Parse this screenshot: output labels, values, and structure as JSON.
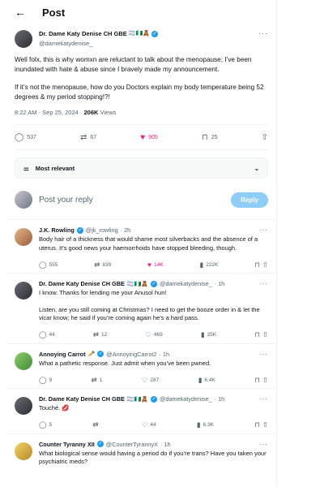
{
  "header": {
    "back_icon": "arrow-left-icon",
    "title": "Post"
  },
  "post": {
    "author_name": "Dr. Dame Katy Denise CH GBE",
    "author_emoji": "🏳️‍⚧️🇳🇬🧸",
    "handle": "@damekatydenise_",
    "more": "···",
    "paragraphs": [
      "Well folx, this is why womxn are reluctant to talk about the menopause; I’ve been inundated with hate & abuse since I bravely made my announcement.",
      "If it’s not the menopause, how do you Doctors explain my body temperature being 52 degrees & my period stopping!?!"
    ],
    "time": "8:22 AM · Sep 25, 2024 · ",
    "views_count": "206K",
    "views_label": " Views",
    "stats": {
      "replies": "537",
      "reposts": "67",
      "likes": "905",
      "bookmarks": "25"
    }
  },
  "sort": {
    "label": "Most relevant"
  },
  "compose": {
    "placeholder": "Post your reply",
    "button": "Reply"
  },
  "replies": [
    {
      "name": "J.K. Rowling",
      "emoji": "",
      "handle": "@jk_rowling",
      "time": "· 2h",
      "text": [
        "Body hair of a thickness that would shame most silverbacks and the absence of a uterus. It’s good news your haemorrhoids have stopped bleeding, though."
      ],
      "replies": "555",
      "reposts": "839",
      "likes": "14K",
      "views": "222K"
    },
    {
      "name": "Dr. Dame Katy Denise CH GBE",
      "emoji": "🏳️‍⚧️🇳🇬🧸",
      "handle": "@damekatydenise_",
      "time": "· 1h",
      "text": [
        "I know. Thanks for lending me your Anusol hun!",
        "Listen, are you still coming at Christmas? I need to get the booze order in & let the vicar know; he said if you’re coming again he’s a hard pass."
      ],
      "replies": "44",
      "reposts": "12",
      "likes": "469",
      "views": "25K"
    },
    {
      "name": "Annoying Carrot",
      "emoji": "🥕",
      "handle": "@AnnoyingCarrot2",
      "time": "· 1h",
      "text": [
        "What a pathetic response. Just admit when you’ve been pwned."
      ],
      "replies": "9",
      "reposts": "1",
      "likes": "287",
      "views": "6.4K"
    },
    {
      "name": "Dr. Dame Katy Denise CH GBE",
      "emoji": "🏳️‍⚧️🇳🇬🧸",
      "handle": "@damekatydenise_",
      "time": "· 1h",
      "text": [
        "Touché. 💋"
      ],
      "replies": "5",
      "reposts": "",
      "likes": "44",
      "views": "6.3K"
    },
    {
      "name": "Counter Tyranny XII",
      "emoji": "",
      "handle": "@CounterTyrannyX",
      "time": "· 1h",
      "text": [
        "What biological sense would having a period do if you’re trans? Have you taken your psychiatric meds?"
      ],
      "replies": "",
      "reposts": "",
      "likes": "",
      "views": ""
    }
  ],
  "colors": {
    "accent": "#1d9bf0",
    "like": "#f91880",
    "reply_button": "#8ecdf8",
    "text": "#0f1419",
    "muted": "#536471"
  }
}
